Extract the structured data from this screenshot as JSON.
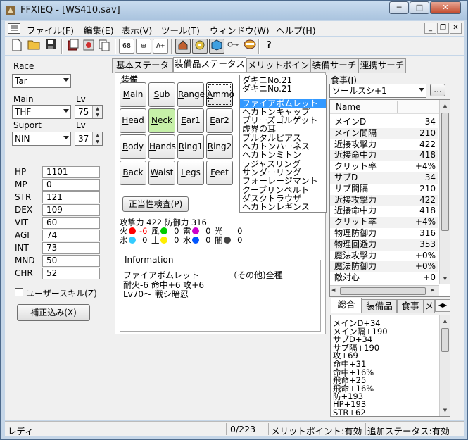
{
  "window": {
    "title": "FFXIEQ - [WS410.sav]"
  },
  "menu": [
    "ファイル(F)",
    "編集(E)",
    "表示(V)",
    "ツール(T)",
    "ウィンドウ(W)",
    "ヘルプ(H)"
  ],
  "toolbar": {
    "btn_68": "68",
    "btn_equip_set": "⊞",
    "btn_aplus": "A+",
    "btn_help": "?"
  },
  "left": {
    "race_label": "Race",
    "race_value": "Tar",
    "main_label": "Main",
    "main_value": "THF",
    "main_lv_label": "Lv",
    "main_lv": "75",
    "support_label": "Suport",
    "support_value": "NIN",
    "support_lv_label": "Lv",
    "support_lv": "37",
    "stats": [
      {
        "name": "HP",
        "value": "1101"
      },
      {
        "name": "MP",
        "value": "0"
      },
      {
        "name": "STR",
        "value": "121"
      },
      {
        "name": "DEX",
        "value": "109"
      },
      {
        "name": "VIT",
        "value": "60"
      },
      {
        "name": "AGI",
        "value": "74"
      },
      {
        "name": "INT",
        "value": "73"
      },
      {
        "name": "MND",
        "value": "50"
      },
      {
        "name": "CHR",
        "value": "52"
      }
    ],
    "user_skill_label": "ユーザースキル(Z)",
    "corrected_button": "補正込み(X)"
  },
  "tabs": [
    "基本ステータス",
    "装備品ステータス",
    "メリットポイント",
    "装備サーチ",
    "連携サーチ"
  ],
  "equip": {
    "group_label": "装備",
    "slots": [
      "Main",
      "Sub",
      "Range",
      "Ammo",
      "Head",
      "Neck",
      "Ear1",
      "Ear2",
      "Body",
      "Hands",
      "Ring1",
      "Ring2",
      "Back",
      "Waist",
      "Legs",
      "Feet"
    ],
    "mnemonics": [
      "M",
      "S",
      "R",
      "A",
      "H",
      "N",
      "E",
      "E",
      "B",
      "H",
      "R",
      "R",
      "B",
      "W",
      "L",
      "F"
    ],
    "validity_button": "正当性検査(P)",
    "attack_defense": "攻撃力 422 防御力 316",
    "elements": [
      {
        "label": "火",
        "color": "#ff0000",
        "value": "-6",
        "neg": true
      },
      {
        "label": "風",
        "color": "#00cc00",
        "value": "0"
      },
      {
        "label": "雷",
        "color": "#cc00cc",
        "value": "0"
      },
      {
        "label": "光",
        "color": "#ffffff",
        "value": "0"
      },
      {
        "label": "氷",
        "color": "#33ccff",
        "value": "0"
      },
      {
        "label": "土",
        "color": "#ffee00",
        "value": "0"
      },
      {
        "label": "水",
        "color": "#0055ff",
        "value": "0"
      },
      {
        "label": "闇",
        "color": "#444444",
        "value": "0"
      }
    ],
    "info_title": "Information",
    "info_lines": [
      "ファイアボムレット　　　　（その他)全種",
      "耐火-6 命中+6 攻+6",
      "Lv70～ 戦シ暗忍"
    ]
  },
  "item_list_top": [
    "ダキニNo.21",
    "ダキニNo.21"
  ],
  "item_list": [
    "ファイアボムレット",
    "ヘカトンキャップ",
    "ブリーズゴルゲット",
    "虚界の耳",
    "ブルタルピアス",
    "ヘカトンハーネス",
    "ヘカトンミトン",
    "ラジャスリング",
    "サンダーリング",
    "フォーレージマント",
    "クーブリンベルト",
    "ダスクトラウザ",
    "ヘカトンレギンス"
  ],
  "food": {
    "label": "食事(J)",
    "value": "ソールスシ+1",
    "more_button": "..."
  },
  "stats_list": {
    "header": "Name",
    "rows": [
      {
        "name": "メインD",
        "value": "34"
      },
      {
        "name": "メイン間隔",
        "value": "210"
      },
      {
        "name": "近接攻撃力",
        "value": "422"
      },
      {
        "name": "近接命中力",
        "value": "418"
      },
      {
        "name": "クリット率",
        "value": "+4%"
      },
      {
        "name": "サブD",
        "value": "34"
      },
      {
        "name": "サブ間隔",
        "value": "210"
      },
      {
        "name": "近接攻撃力",
        "value": "422"
      },
      {
        "name": "近接命中力",
        "value": "418"
      },
      {
        "name": "クリット率",
        "value": "+4%"
      },
      {
        "name": "物理防御力",
        "value": "316"
      },
      {
        "name": "物理回避力",
        "value": "353"
      },
      {
        "name": "魔法攻撃力",
        "value": "+0%"
      },
      {
        "name": "魔法防御力",
        "value": "+0%"
      },
      {
        "name": "敵対心",
        "value": "+0"
      }
    ]
  },
  "bottom_tabs": [
    "総合",
    "装備品",
    "食事",
    "メ"
  ],
  "summary": [
    "メインD+34",
    "メイン隔+190",
    "サブD+34",
    "サブ隔+190",
    "攻+69",
    "命中+31",
    "命中+16%",
    "飛命+25",
    "飛命+16%",
    "防+193",
    "HP+193",
    "STR+62"
  ],
  "status": {
    "ready": "レディ",
    "count": "0/223",
    "merit": "メリットポイント:有効",
    "extra": "追加ステータス:有効"
  }
}
